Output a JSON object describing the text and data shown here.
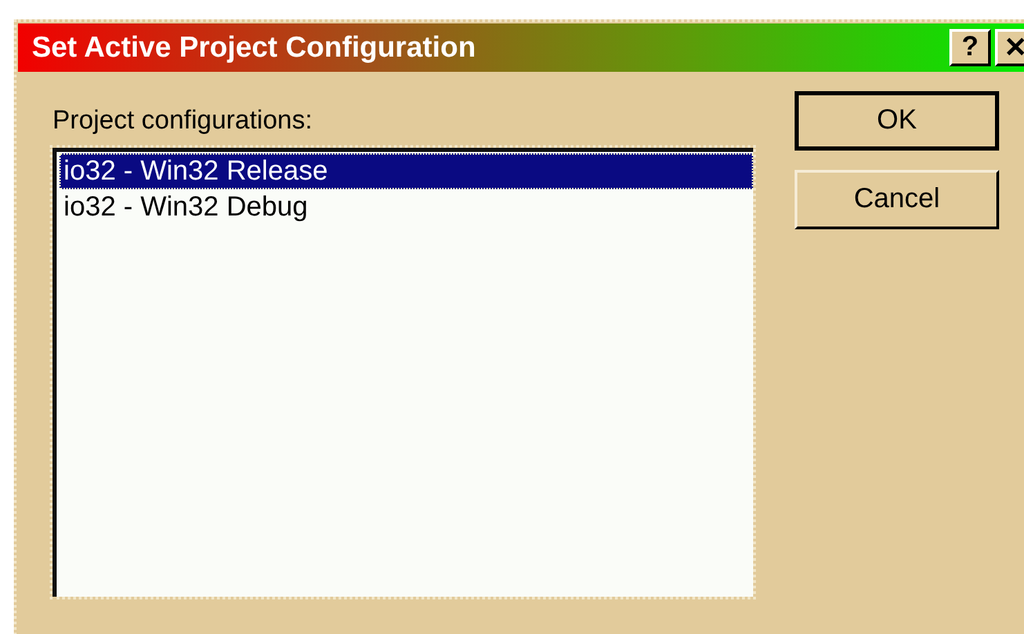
{
  "window": {
    "title": "Set Active Project Configuration",
    "title_buttons": [
      "?",
      "✕"
    ]
  },
  "list": {
    "label": "Project configurations:",
    "items": [
      {
        "text": "io32 - Win32 Release",
        "selected": true
      },
      {
        "text": "io32 - Win32 Debug",
        "selected": false
      }
    ]
  },
  "buttons": [
    {
      "label": "OK",
      "default": true
    },
    {
      "label": "Cancel",
      "default": false
    }
  ]
}
